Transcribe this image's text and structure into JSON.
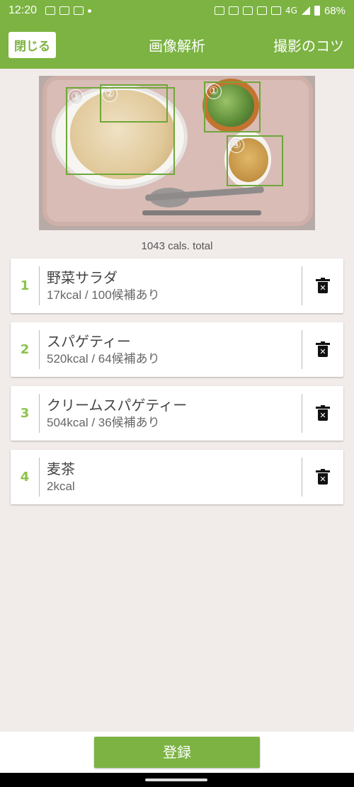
{
  "status_bar": {
    "time": "12:20",
    "network": "4G",
    "battery": "68%"
  },
  "app_bar": {
    "close_label": "閉じる",
    "title": "画像解析",
    "tips_label": "撮影のコツ"
  },
  "photo": {
    "boxes": [
      {
        "num": "①"
      },
      {
        "num": "②"
      },
      {
        "num": "③"
      },
      {
        "num": "④"
      }
    ]
  },
  "total": "1043 cals. total",
  "items": [
    {
      "index": "1",
      "name": "野菜サラダ",
      "detail": "17kcal / 100候補あり"
    },
    {
      "index": "2",
      "name": "スパゲティー",
      "detail": "520kcal / 64候補あり"
    },
    {
      "index": "3",
      "name": "クリームスパゲティー",
      "detail": "504kcal / 36候補あり"
    },
    {
      "index": "4",
      "name": "麦茶",
      "detail": "2kcal"
    }
  ],
  "register_label": "登録",
  "colors": {
    "accent": "#7cb342",
    "background": "#f1ecea"
  },
  "icons": {
    "delete": "trash-x-icon"
  }
}
